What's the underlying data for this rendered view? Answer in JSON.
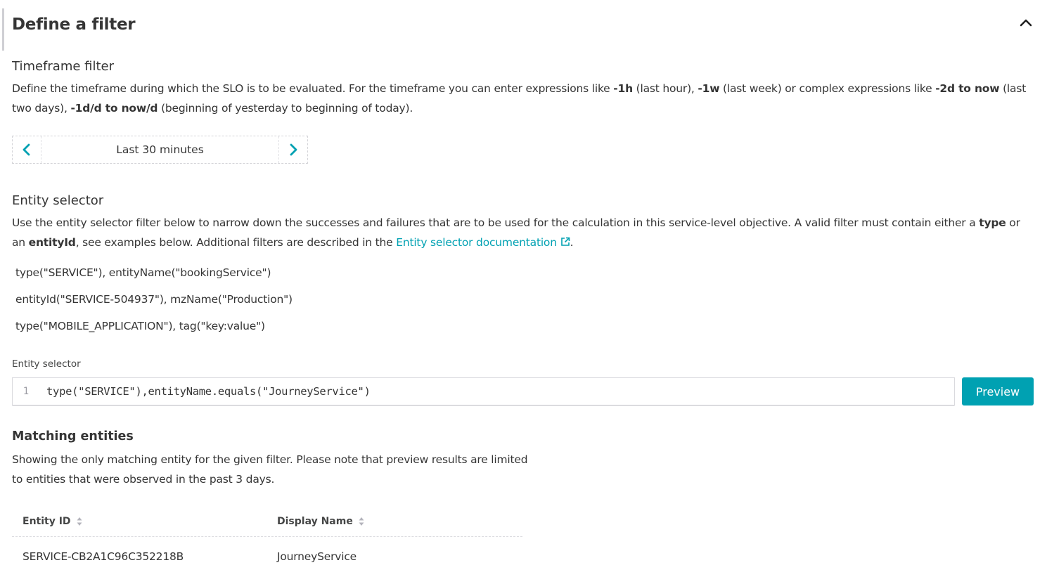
{
  "section": {
    "title": "Define a filter"
  },
  "timeframe": {
    "heading": "Timeframe filter",
    "desc": {
      "t1": "Define the timeframe during which the SLO is to be evaluated. For the timeframe you can enter expressions like ",
      "b1": "-1h",
      "t2": " (last hour), ",
      "b2": "-1w",
      "t3": " (last week) or complex expressions like ",
      "b3": "-2d to now",
      "t4": " (last two days), ",
      "b4": "-1d/d to now/d",
      "t5": " (beginning of yesterday to beginning of today)."
    },
    "value": "Last 30 minutes"
  },
  "entity": {
    "heading": "Entity selector",
    "desc": {
      "t1": "Use the entity selector filter below to narrow down the successes and failures that are to be used for the calculation in this service-level objective. A valid filter must contain either a ",
      "b1": "type",
      "t2": " or an ",
      "b2": "entityId",
      "t3": ", see examples below. Additional filters are described in the ",
      "link": "Entity selector documentation",
      "t4": "."
    },
    "examples": [
      "type(\"SERVICE\"), entityName(\"bookingService\")",
      "entityId(\"SERVICE-504937\"), mzName(\"Production\")",
      "type(\"MOBILE_APPLICATION\"), tag(\"key:value\")"
    ],
    "field_label": "Entity selector",
    "line_number": "1",
    "code": "type(\"SERVICE\"),entityName.equals(\"JourneyService\")",
    "preview_label": "Preview"
  },
  "matching": {
    "heading": "Matching entities",
    "desc": "Showing the only matching entity for the given filter. Please note that preview results are limited to entities that were observed in the past 3 days.",
    "columns": [
      "Entity ID",
      "Display Name"
    ],
    "rows": [
      [
        "SERVICE-CB2A1C96C352218B",
        "JourneyService"
      ]
    ]
  },
  "colors": {
    "accent": "#00a1b2",
    "text": "#353535"
  }
}
